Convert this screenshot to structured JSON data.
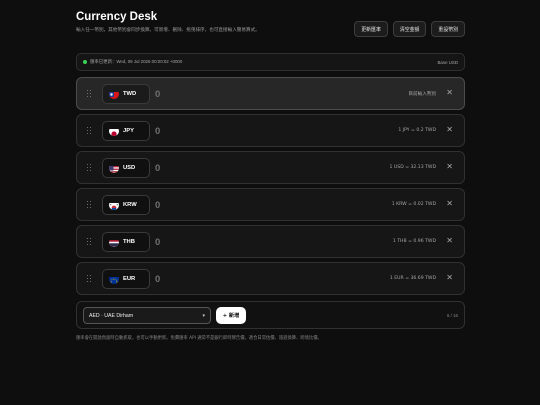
{
  "header": {
    "title": "Currency Desk",
    "subtitle": "輸入任一幣別，其他幣別會同步換算。可新增、刪除、拖曳排序，也可直接輸入簡易算式。",
    "buttons": {
      "refresh": "更新匯率",
      "clear": "清空金額",
      "reset": "重設幣別"
    }
  },
  "status": {
    "updated": "匯率已更新：Wed, 09 Jul 2026 00:00:02 +0000",
    "base": "Base USD",
    "dot_color": "#39d353"
  },
  "rows": [
    {
      "code": "TWD",
      "amount": "0",
      "rate": "目前輸入幣別",
      "active": true,
      "flag": "taiwan-flag"
    },
    {
      "code": "JPY",
      "amount": "0",
      "rate": "1 JPY = 0.2 TWD",
      "active": false,
      "flag": "japan-flag"
    },
    {
      "code": "USD",
      "amount": "0",
      "rate": "1 USD = 32.13 TWD",
      "active": false,
      "flag": "usa-flag"
    },
    {
      "code": "KRW",
      "amount": "0",
      "rate": "1 KRW = 0.02 TWD",
      "active": false,
      "flag": "korea-flag"
    },
    {
      "code": "THB",
      "amount": "0",
      "rate": "1 THB = 0.96 TWD",
      "active": false,
      "flag": "thailand-flag"
    },
    {
      "code": "EUR",
      "amount": "0",
      "rate": "1 EUR = 36.69 TWD",
      "active": false,
      "flag": "eu-flag"
    }
  ],
  "add": {
    "selected": "AED · UAE Dirham",
    "button": "+ 新增",
    "count": "6 / 16"
  },
  "note": "匯率會在開啟頁面時自動抓取，也可以手動更新。免費匯率 API 通常不是銀行即時牌告價，適合日常估價、旅遊換算、跨境比價。"
}
